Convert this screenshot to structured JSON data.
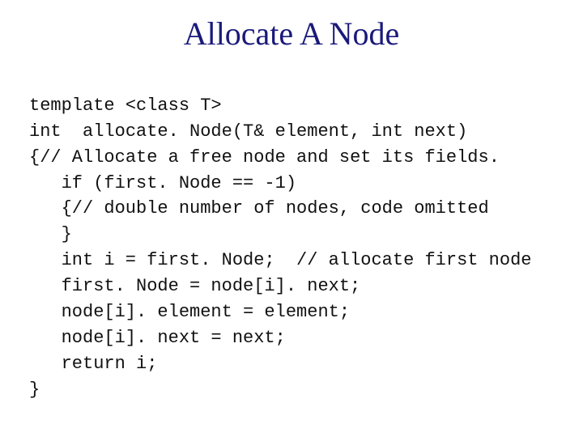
{
  "title": "Allocate A Node",
  "code": {
    "l1": "template <class T>",
    "l2": "int  allocate. Node(T& element, int next)",
    "l3a": "{",
    "l3b": "// Allocate a free node and set its fields.",
    "l4": "if (first. Node == -1)",
    "l5a": "{",
    "l5b": "// double number of nodes, code omitted",
    "l6": "}",
    "l7": "int i = first. Node;  // allocate first node",
    "l8": "first. Node = node[i]. next;",
    "l9": "node[i]. element = element;",
    "l10": "node[i]. next = next;",
    "l11": "return i;",
    "l12": "}"
  }
}
